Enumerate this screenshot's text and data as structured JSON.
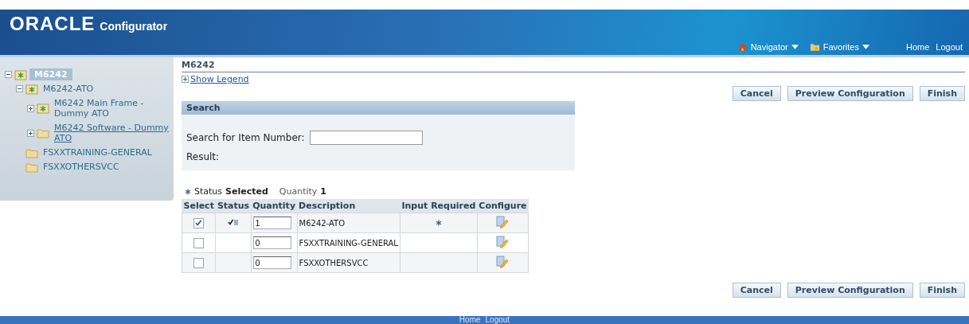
{
  "header": {
    "logo": "ORACLE",
    "product": "Configurator",
    "nav": [
      {
        "label": "Navigator",
        "kind": "home"
      },
      {
        "label": "Favorites",
        "kind": "folder"
      }
    ],
    "links": [
      "Home",
      "Logout"
    ]
  },
  "tree": [
    {
      "label": "M6242",
      "kind": "star-folder",
      "expanded": true,
      "selected": true,
      "underlined": false,
      "children": [
        {
          "label": "M6242-ATO",
          "kind": "star-folder",
          "expanded": true,
          "selected": false,
          "underlined": false,
          "children": [
            {
              "label": "M6242 Main Frame - Dummy ATO",
              "kind": "star-folder",
              "expanded": false,
              "selected": false,
              "underlined": false
            },
            {
              "label": "M6242 Software - Dummy ATO",
              "kind": "folder",
              "expanded": false,
              "selected": false,
              "underlined": true
            }
          ]
        },
        {
          "label": "FSXXTRAINING-GENERAL",
          "kind": "folder",
          "selected": false,
          "underlined": false
        },
        {
          "label": "FSXXOTHERSVCC",
          "kind": "folder",
          "selected": false,
          "underlined": false
        }
      ]
    }
  ],
  "page_title": "M6242",
  "legend_link": "Show Legend",
  "buttons": [
    "Cancel",
    "Preview Configuration",
    "Finish"
  ],
  "search": {
    "title": "Search",
    "label": "Search for Item Number:",
    "result_label": "Result:"
  },
  "legend": {
    "status_label": "Status",
    "status_value": "Selected",
    "quantity_label": "Quantity",
    "quantity_value": "1"
  },
  "table": {
    "columns": [
      "Select",
      "Status",
      "Quantity",
      "Description",
      "Input Required",
      "Configure"
    ],
    "rows": [
      {
        "checked": true,
        "status_selected": true,
        "quantity": "1",
        "description": "M6242-ATO",
        "input_required": true
      },
      {
        "checked": false,
        "status_selected": false,
        "quantity": "0",
        "description": "FSXXTRAINING-GENERAL",
        "input_required": false
      },
      {
        "checked": false,
        "status_selected": false,
        "quantity": "0",
        "description": "FSXXOTHERSVCC",
        "input_required": false
      }
    ]
  },
  "bottom_buttons": [
    "Cancel",
    "Preview Configuration",
    "Finish"
  ],
  "footer_links": [
    "Home",
    "Logout"
  ]
}
